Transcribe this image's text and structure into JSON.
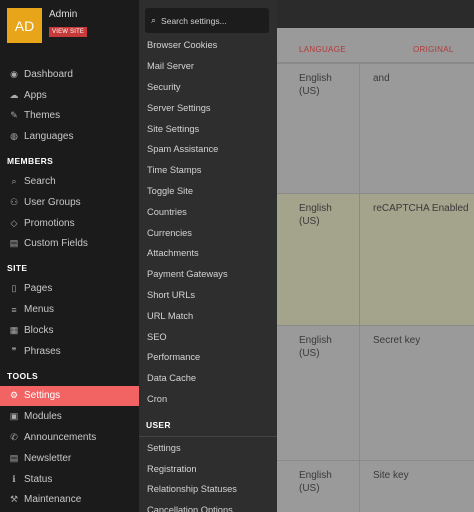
{
  "profile": {
    "initials": "AD",
    "name": "Admin",
    "view_site": "VIEW SITE"
  },
  "sidebar": {
    "top_items": [
      {
        "icon": "dashboard-icon",
        "glyph": "◉",
        "label": "Dashboard"
      },
      {
        "icon": "apps-icon",
        "glyph": "☁",
        "label": "Apps"
      },
      {
        "icon": "brush-icon",
        "glyph": "✎",
        "label": "Themes"
      },
      {
        "icon": "globe-icon",
        "glyph": "◍",
        "label": "Languages"
      }
    ],
    "members_label": "MEMBERS",
    "members_items": [
      {
        "icon": "search-icon",
        "glyph": "⌕",
        "label": "Search"
      },
      {
        "icon": "users-icon",
        "glyph": "⚇",
        "label": "User Groups"
      },
      {
        "icon": "diamond-icon",
        "glyph": "◇",
        "label": "Promotions"
      },
      {
        "icon": "list-icon",
        "glyph": "▤",
        "label": "Custom Fields"
      }
    ],
    "site_label": "SITE",
    "site_items": [
      {
        "icon": "file-icon",
        "glyph": "▯",
        "label": "Pages"
      },
      {
        "icon": "menu-icon",
        "glyph": "≡",
        "label": "Menus"
      },
      {
        "icon": "blocks-icon",
        "glyph": "▦",
        "label": "Blocks"
      },
      {
        "icon": "quote-icon",
        "glyph": "❞",
        "label": "Phrases"
      }
    ],
    "tools_label": "TOOLS",
    "tools_items": [
      {
        "icon": "gear-icon",
        "glyph": "⚙",
        "label": "Settings",
        "active": true
      },
      {
        "icon": "puzzle-icon",
        "glyph": "▣",
        "label": "Modules"
      },
      {
        "icon": "megaphone-icon",
        "glyph": "✆",
        "label": "Announcements"
      },
      {
        "icon": "newspaper-icon",
        "glyph": "▤",
        "label": "Newsletter"
      },
      {
        "icon": "info-icon",
        "glyph": "ℹ",
        "label": "Status"
      },
      {
        "icon": "wrench-icon",
        "glyph": "⚒",
        "label": "Maintenance"
      }
    ]
  },
  "dropdown": {
    "search_placeholder": "Search settings...",
    "items": [
      "Browser Cookies",
      "Mail Server",
      "Security",
      "Server Settings",
      "Site Settings",
      "Spam Assistance",
      "Time Stamps",
      "Toggle Site",
      "Countries",
      "Currencies",
      "Attachments",
      "Payment Gateways",
      "Short URLs",
      "URL Match",
      "SEO",
      "Performance",
      "Data Cache",
      "Cron"
    ],
    "user_label": "USER",
    "user_items": [
      "Settings",
      "Registration",
      "Relationship Statuses",
      "Cancellation Options"
    ]
  },
  "table": {
    "col_language": "LANGUAGE",
    "col_original": "ORIGINAL",
    "rows": [
      {
        "language": "English (US)",
        "original": "and"
      },
      {
        "language": "English (US)",
        "original": "reCAPTCHA Enabled"
      },
      {
        "language": "English (US)",
        "original": "Secret key"
      },
      {
        "language": "English (US)",
        "original": "Site key"
      }
    ]
  }
}
